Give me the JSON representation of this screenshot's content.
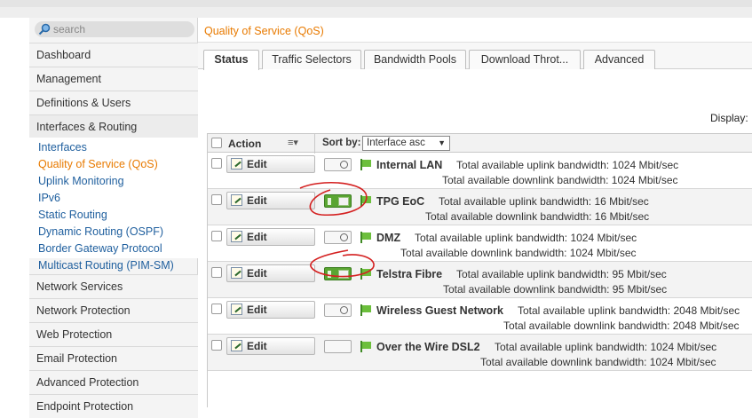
{
  "sidebar": {
    "search_placeholder": "search",
    "items": [
      {
        "label": "Dashboard"
      },
      {
        "label": "Management"
      },
      {
        "label": "Definitions & Users"
      },
      {
        "label": "Interfaces & Routing"
      },
      {
        "label": "Network Services"
      },
      {
        "label": "Network Protection"
      },
      {
        "label": "Web Protection"
      },
      {
        "label": "Email Protection"
      },
      {
        "label": "Advanced Protection"
      },
      {
        "label": "Endpoint Protection"
      }
    ],
    "subitems": [
      {
        "label": "Interfaces"
      },
      {
        "label": "Quality of Service (QoS)"
      },
      {
        "label": "Uplink Monitoring"
      },
      {
        "label": "IPv6"
      },
      {
        "label": "Static Routing"
      },
      {
        "label": "Dynamic Routing (OSPF)"
      },
      {
        "label": "Border Gateway Protocol"
      },
      {
        "label": "Multicast Routing (PIM-SM)"
      }
    ]
  },
  "header": {
    "title": "Quality of Service (QoS)"
  },
  "tabs": [
    {
      "label": "Status"
    },
    {
      "label": "Traffic Selectors"
    },
    {
      "label": "Bandwidth Pools"
    },
    {
      "label": "Download Throt..."
    },
    {
      "label": "Advanced"
    }
  ],
  "toolbar": {
    "display_label": "Display:"
  },
  "table": {
    "action_header": "Action",
    "sort_by_label": "Sort by:",
    "sort_value": "Interface asc",
    "edit_label": "Edit",
    "rows": [
      {
        "name": "Internal LAN",
        "enabled": false,
        "uplink": "Total available uplink bandwidth: 1024 Mbit/sec",
        "downlink": "Total available downlink bandwidth: 1024 Mbit/sec"
      },
      {
        "name": "TPG EoC",
        "enabled": true,
        "uplink": "Total available uplink bandwidth: 16 Mbit/sec",
        "downlink": "Total available downlink bandwidth: 16 Mbit/sec"
      },
      {
        "name": "DMZ",
        "enabled": false,
        "uplink": "Total available uplink bandwidth: 1024 Mbit/sec",
        "downlink": "Total available downlink bandwidth: 1024 Mbit/sec"
      },
      {
        "name": "Telstra Fibre",
        "enabled": true,
        "uplink": "Total available uplink bandwidth: 95 Mbit/sec",
        "downlink": "Total available downlink bandwidth: 95 Mbit/sec"
      },
      {
        "name": "Wireless Guest Network",
        "enabled": false,
        "uplink": "Total available uplink bandwidth: 2048 Mbit/sec",
        "downlink": "Total available downlink bandwidth: 2048 Mbit/sec"
      },
      {
        "name": "Over the Wire DSL2",
        "enabled": false,
        "uplink": "Total available uplink bandwidth: 1024 Mbit/sec",
        "downlink": "Total available downlink bandwidth: 1024 Mbit/sec"
      }
    ]
  },
  "colors": {
    "accent": "#e87a00",
    "link": "#1f5f9e",
    "toggle_on": "#5aa532",
    "annotation": "#d42020"
  }
}
